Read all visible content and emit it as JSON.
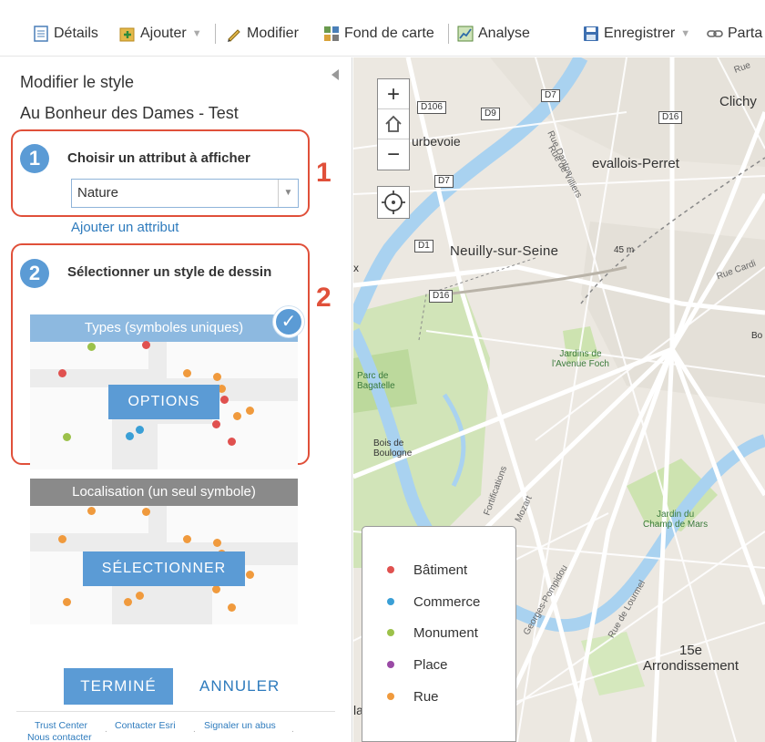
{
  "toolbar": {
    "details": "Détails",
    "add": "Ajouter",
    "modify": "Modifier",
    "basemap": "Fond de carte",
    "analysis": "Analyse",
    "save": "Enregistrer",
    "share": "Parta"
  },
  "panel": {
    "title": "Modifier le style",
    "layer_name": "Au Bonheur des Dames - Test",
    "step1": {
      "number": "1",
      "label": "Choisir un attribut à afficher",
      "annotation": "1",
      "selected_attribute": "Nature",
      "add_attribute": "Ajouter un attribut"
    },
    "step2": {
      "number": "2",
      "label": "Sélectionner un style de dessin",
      "annotation": "2"
    },
    "style_types": {
      "title": "Types (symboles uniques)",
      "button": "OPTIONS"
    },
    "style_location": {
      "title": "Localisation (un seul symbole)",
      "button": "SÉLECTIONNER"
    },
    "done": "TERMINÉ",
    "cancel": "ANNULER",
    "footer": {
      "trust": "Trust Center",
      "contact_esri": "Contacter Esri",
      "report": "Signaler un abus",
      "contact": "Nous contacter"
    }
  },
  "map": {
    "labels": {
      "clichy": "Clichy",
      "courbevoie": "urbevoie",
      "levallois": "evallois-Perret",
      "neuilly": "Neuilly-sur-Seine",
      "elev": "45 m",
      "jardins_foch": "Jardins de\nl'Avenue Foch",
      "parc_bagatelle": "Parc de\nBagatelle",
      "bois_boulogne": "Bois de\nBoulogne",
      "champ_mars": "Jardin du\nChamp de Mars",
      "arr15": "15e\nArrondissement",
      "rue_danton": "Rue Danton",
      "rue_villiers": "Rue de Villiers",
      "rue_cardinet": "Rue Cardi",
      "fortifications": "Fortifications",
      "mozart": "Mozart",
      "georges_pompidou": "Georges-Pompidou",
      "rue_lourmel": "Rue de Lourmel",
      "rue_top": "Rue",
      "bo": "Bo",
      "x": "x",
      "la": "la"
    },
    "shields": {
      "d106": "D106",
      "d9": "D9",
      "d7a": "D7",
      "d16a": "D16",
      "d7b": "D7",
      "d1": "D1",
      "d16b": "D16"
    }
  },
  "legend": {
    "items": [
      {
        "label": "Bâtiment",
        "color": "#e0514f"
      },
      {
        "label": "Commerce",
        "color": "#3a9fd6"
      },
      {
        "label": "Monument",
        "color": "#9cc14a"
      },
      {
        "label": "Place",
        "color": "#9a4aa5"
      },
      {
        "label": "Rue",
        "color": "#f09a3d"
      }
    ]
  },
  "colors": {
    "accent": "#5b9bd5",
    "highlight": "#e0503a",
    "link": "#2e7bbd",
    "water": "#a9d2f0",
    "park": "#cde3b0"
  }
}
